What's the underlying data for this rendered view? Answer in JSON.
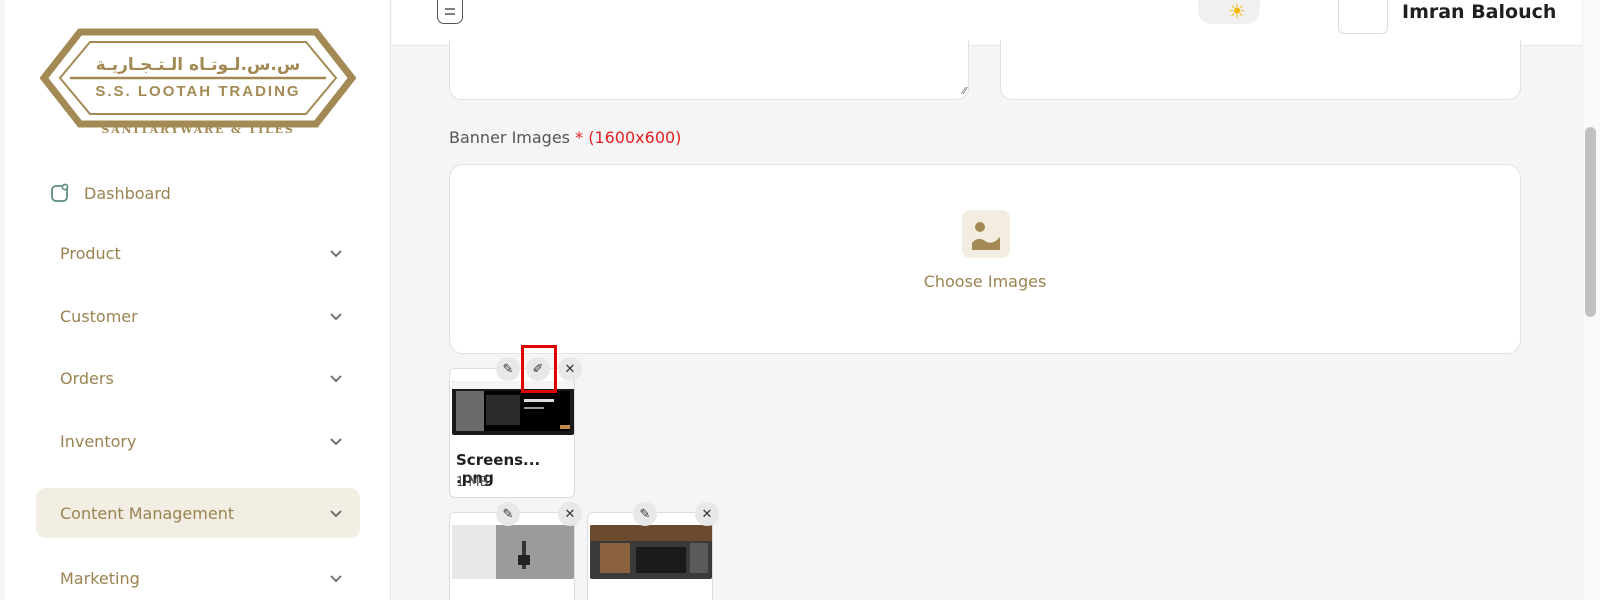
{
  "brand": {
    "arabic_name": "س.س.لـوتـاه الـتـجـاريـة",
    "english_name": "S.S. LOOTAH TRADING",
    "tagline": "SANITARYWARE & TILES",
    "accent_color": "#a38a55"
  },
  "sidebar": {
    "dashboard_label": "Dashboard",
    "items": [
      {
        "label": "Product"
      },
      {
        "label": "Customer"
      },
      {
        "label": "Orders"
      },
      {
        "label": "Inventory"
      },
      {
        "label": "Content Management",
        "active": true
      },
      {
        "label": "Marketing"
      }
    ]
  },
  "topbar": {
    "user_name": "Imran Balouch",
    "theme_icon": "sun-icon"
  },
  "form": {
    "banner_label": "Banner Images",
    "required_mark": "*",
    "size_hint": "(1600x600)",
    "choose_images_label": "Choose Images"
  },
  "files": [
    {
      "name": "Screens... .png",
      "size": "1 MB"
    },
    {
      "name": "",
      "size": ""
    },
    {
      "name": "",
      "size": ""
    }
  ]
}
